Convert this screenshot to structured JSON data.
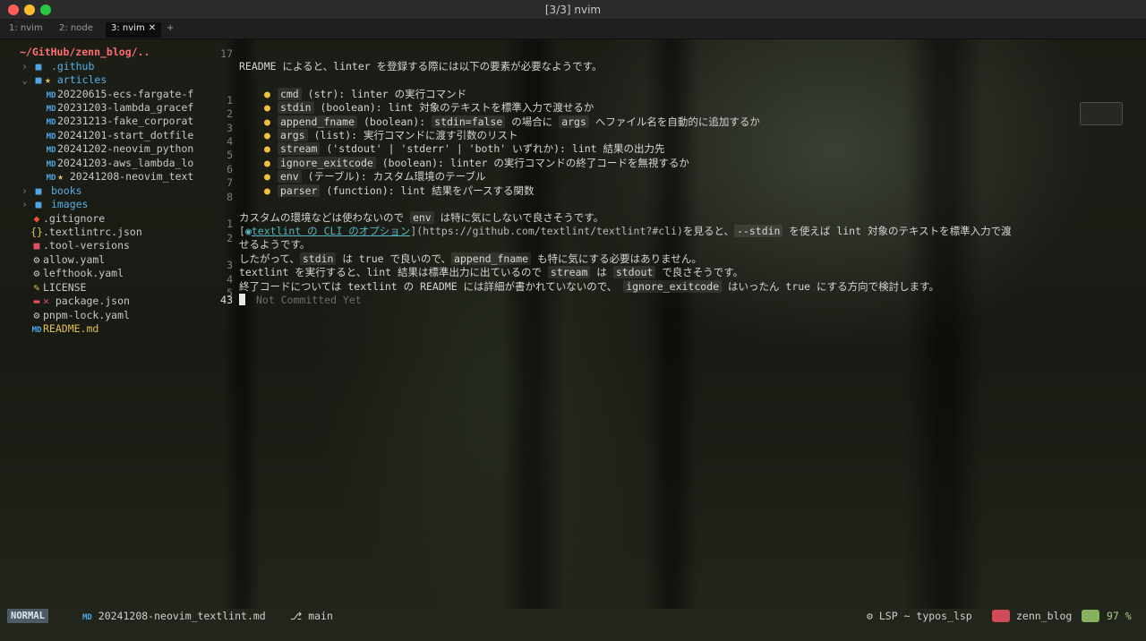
{
  "window": {
    "title": "[3/3] nvim"
  },
  "tabs": [
    {
      "label": "1: nvim"
    },
    {
      "label": "2: node"
    },
    {
      "label": "3: nvim",
      "close": "✕"
    }
  ],
  "tab_add": "+",
  "tree": {
    "root": "~/GitHub/zenn_blog/..",
    "items": [
      {
        "name": ".github",
        "chev": "›"
      },
      {
        "name": "articles",
        "chev": "⌄",
        "star": "★"
      },
      {
        "name": "20220615-ecs-fargate-f"
      },
      {
        "name": "20231203-lambda_gracef"
      },
      {
        "name": "20231213-fake_corporat"
      },
      {
        "name": "20241201-start_dotfile"
      },
      {
        "name": "20241202-neovim_python"
      },
      {
        "name": "20241203-aws_lambda_lo"
      },
      {
        "name": "20241208-neovim_text",
        "star": "★"
      },
      {
        "name": "books",
        "chev": "›"
      },
      {
        "name": "images",
        "chev": "›"
      },
      {
        "name": ".gitignore"
      },
      {
        "name": ".textlintrc.json"
      },
      {
        "name": ".tool-versions"
      },
      {
        "name": "allow.yaml"
      },
      {
        "name": "lefthook.yaml"
      },
      {
        "name": "LICENSE"
      },
      {
        "name": "package.json",
        "mark": "✕"
      },
      {
        "name": "pnpm-lock.yaml"
      },
      {
        "name": "README.md"
      }
    ]
  },
  "editor": {
    "line_numbers": [
      "17",
      "",
      "",
      "1",
      "2",
      "3",
      "4",
      "5",
      "6",
      "7",
      "8",
      "",
      "1",
      "2",
      "",
      "3",
      "4",
      "5",
      "43"
    ],
    "line1": "README によると、linter を登録する際には以下の要素が必要なようです。",
    "bullets": [
      {
        "code": "cmd",
        "rest": "(str): linter の実行コマンド"
      },
      {
        "code": "stdin",
        "rest": "(boolean): lint 対象のテキストを標準入力で渡せるか"
      },
      {
        "code": "append_fname",
        "rest_a": "(boolean):",
        "code2": "stdin=false",
        "rest_b": "の場合に",
        "code3": "args",
        "rest_c": "へファイル名を自動的に追加するか"
      },
      {
        "code": "args",
        "rest": "(list): 実行コマンドに渡す引数のリスト"
      },
      {
        "code": "stream",
        "rest": "('stdout' | 'stderr' | 'both' いずれか): lint 結果の出力先"
      },
      {
        "code": "ignore_exitcode",
        "rest": "(boolean): linter の実行コマンドの終了コードを無視するか"
      },
      {
        "code": "env",
        "rest": "(テーブル): カスタム環境のテーブル"
      },
      {
        "code": "parser",
        "rest": "(function): lint 結果をパースする関数"
      }
    ],
    "bullet_glyph": "●",
    "para1_a": "カスタムの環境などは使わないので",
    "para1_code": "env",
    "para1_b": "は特に気にしないで良さそうです。",
    "para2_open": "[",
    "para2_icon": "◉",
    "para2_link": "textlint の CLI のオプション",
    "para2_url": "](https://github.com/textlint/textlint?#cli)",
    "para2_a": "を見ると、",
    "para2_code": "--stdin",
    "para2_b": "を使えば lint 対象のテキストを標準入力で渡",
    "para2_wrap": "せるようです。",
    "para3_a": "したがって、",
    "para3_code1": "stdin",
    "para3_b": "は true で良いので、",
    "para3_code2": "append_fname",
    "para3_c": "も特に気にする必要はありません。",
    "para4_a": "textlint を実行すると、lint 結果は標準出力に出ているので",
    "para4_code1": "stream",
    "para4_b": "は",
    "para4_code2": "stdout",
    "para4_c": "で良さそうです。",
    "para5_a": "終了コードについては textlint の README には詳細が書かれていないので、",
    "para5_code": "ignore_exitcode",
    "para5_b": "はいったん true にする方向で検討します。",
    "blame": "Not Committed Yet"
  },
  "status": {
    "mode": "NORMAL",
    "file": "20241208-neovim_textlint.md",
    "branch": "main",
    "lsp": "LSP ~ typos_lsp",
    "project": "zenn_blog",
    "percent": "97 %"
  },
  "colors": {
    "accent_red": "#ff6e6e",
    "folder": "#4fa6e6",
    "bullet": "#f0c040",
    "link": "#56b6c2"
  }
}
